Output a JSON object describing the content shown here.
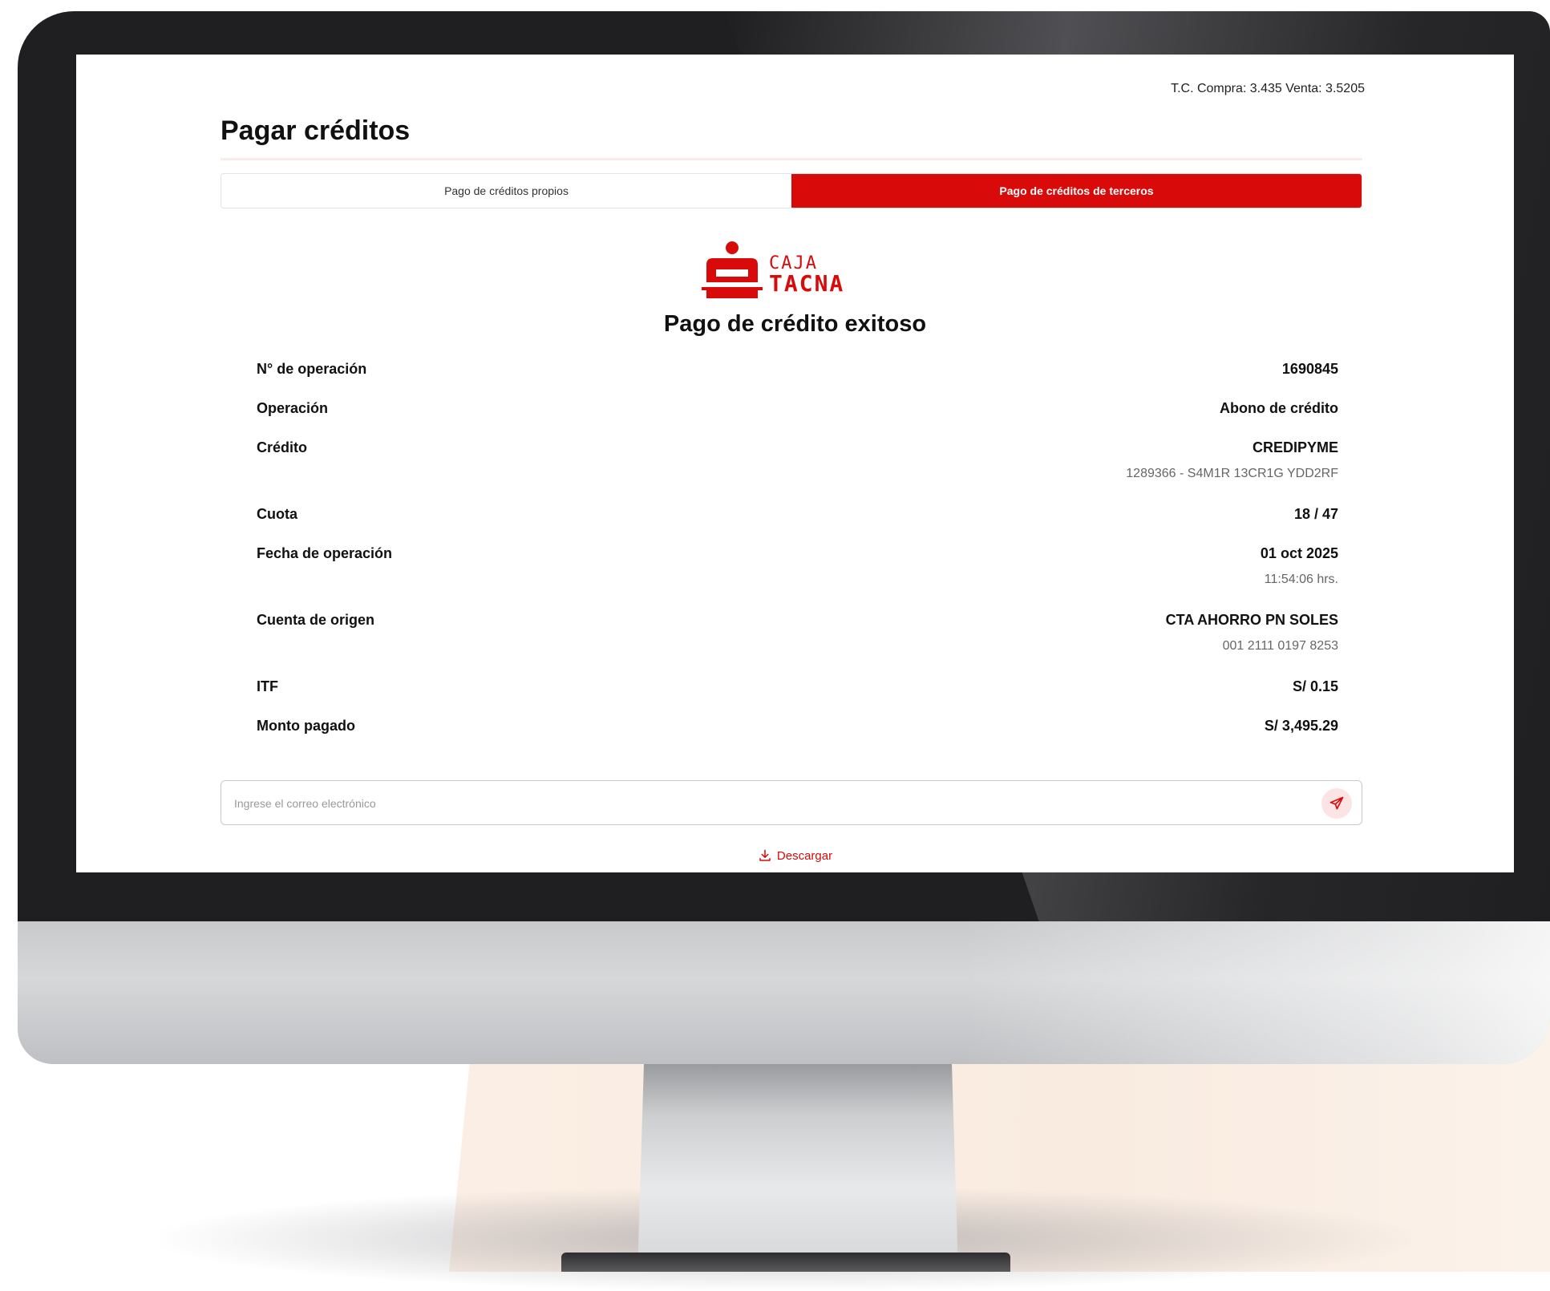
{
  "header": {
    "exchange_rate": "T.C. Compra: 3.435 Venta: 3.5205",
    "title": "Pagar créditos"
  },
  "tabs": [
    {
      "label": "Pago de créditos propios",
      "active": false
    },
    {
      "label": "Pago de créditos de terceros",
      "active": true
    }
  ],
  "brand": {
    "logo_line1": "CAJA",
    "logo_line2": "TACNA",
    "color": "#d90a0a"
  },
  "receipt": {
    "title": "Pago de crédito exitoso",
    "rows": [
      {
        "label": "N° de operación",
        "value": "1690845"
      },
      {
        "label": "Operación",
        "value": "Abono de crédito"
      },
      {
        "label": "Crédito",
        "value": "CREDIPYME",
        "sub": "1289366 - S4M1R 13CR1G YDD2RF"
      },
      {
        "label": "Cuota",
        "value": "18 / 47"
      },
      {
        "label": "Fecha de operación",
        "value": "01 oct 2025",
        "sub": "11:54:06 hrs."
      },
      {
        "label": "Cuenta de origen",
        "value": "CTA AHORRO PN SOLES",
        "sub": "001 2111 0197 8253"
      },
      {
        "label": "ITF",
        "value": "S/ 0.15"
      },
      {
        "label": "Monto pagado",
        "value": "S/ 3,495.29"
      }
    ]
  },
  "email": {
    "placeholder": "Ingrese el correo electrónico",
    "value": "",
    "send_icon": "send-icon"
  },
  "download": {
    "label": "Descargar",
    "icon": "download-icon"
  }
}
